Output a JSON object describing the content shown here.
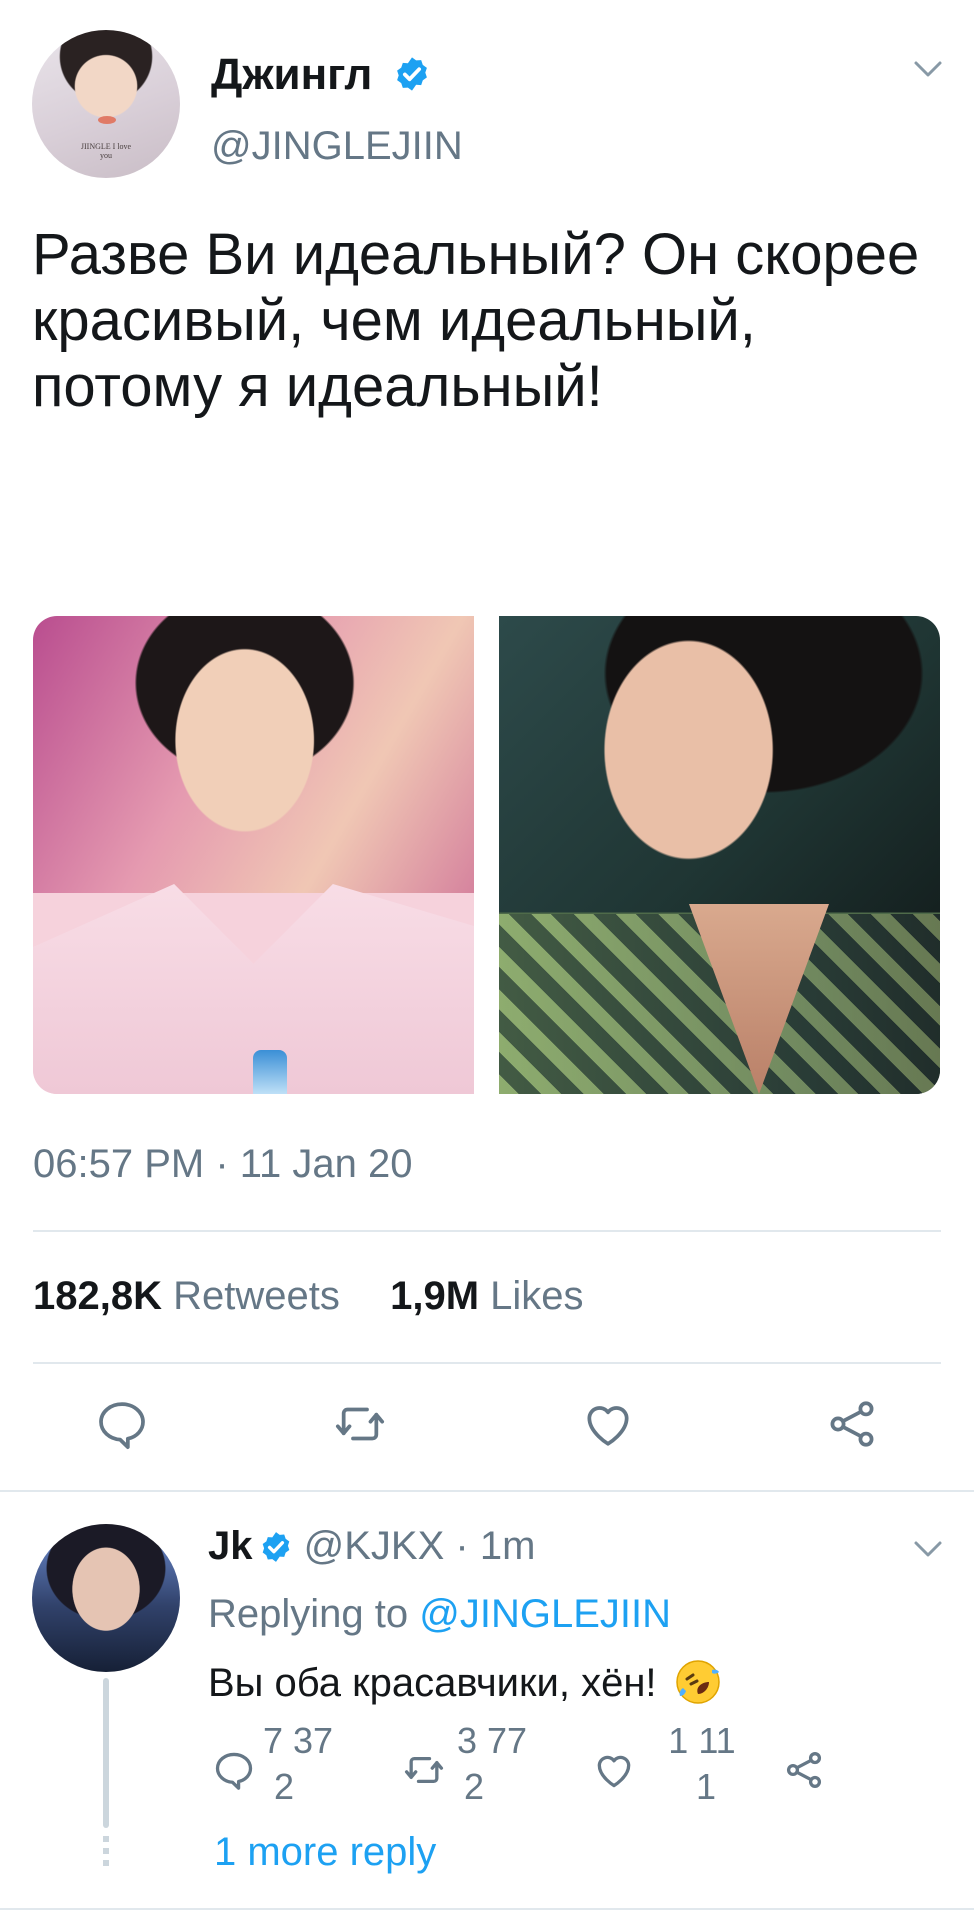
{
  "tweet": {
    "author_name": "Джингл",
    "author_handle": "@JINGLEJIIN",
    "avatar_caption": "JIINGLE I love you",
    "text": "Разве Ви идеальный? Он скорее красивый, чем идеальный, потому я идеальный!",
    "timestamp": "06:57 PM · 11 Jan 20",
    "retweets_count": "182,8K",
    "retweets_label": "Retweets",
    "likes_count": "1,9M",
    "likes_label": "Likes",
    "media_count": 2
  },
  "actions": [
    "reply-icon",
    "retweet-icon",
    "like-icon",
    "share-icon"
  ],
  "reply": {
    "author_name": "Jk",
    "author_handle": "@KJKX",
    "time": "· 1m",
    "replying_prefix": "Replying to",
    "replying_handle": "@JINGLEJIIN",
    "text": "Вы оба красавчики, хён!",
    "reply_count_line1": "7 37",
    "reply_count_line2": "2",
    "retweet_count_line1": "3 77",
    "retweet_count_line2": "2",
    "like_count_line1": "1 11",
    "like_count_line2": "1"
  },
  "thread": {
    "more_replies": "1 more reply"
  },
  "colors": {
    "link": "#1da1f2",
    "secondary_text": "#657786",
    "primary_text": "#14171a",
    "divider": "#e1e8ed"
  }
}
